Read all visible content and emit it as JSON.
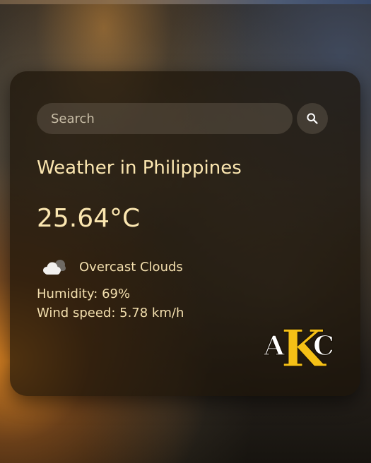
{
  "search": {
    "placeholder": "Search",
    "value": ""
  },
  "weather": {
    "title": "Weather in Philippines",
    "temperature": "25.64°C",
    "condition": "Overcast Clouds",
    "condition_icon": "overcast-clouds-icon",
    "humidity": "Humidity: 69%",
    "wind": "Wind speed: 5.78 km/h"
  },
  "logo": {
    "text": "AKC",
    "primary_color": "#f5c016",
    "secondary_color": "#ffffff"
  },
  "colors": {
    "text_primary": "#fbe6b0",
    "card_background": "rgba(28,20,8,0.72)"
  }
}
